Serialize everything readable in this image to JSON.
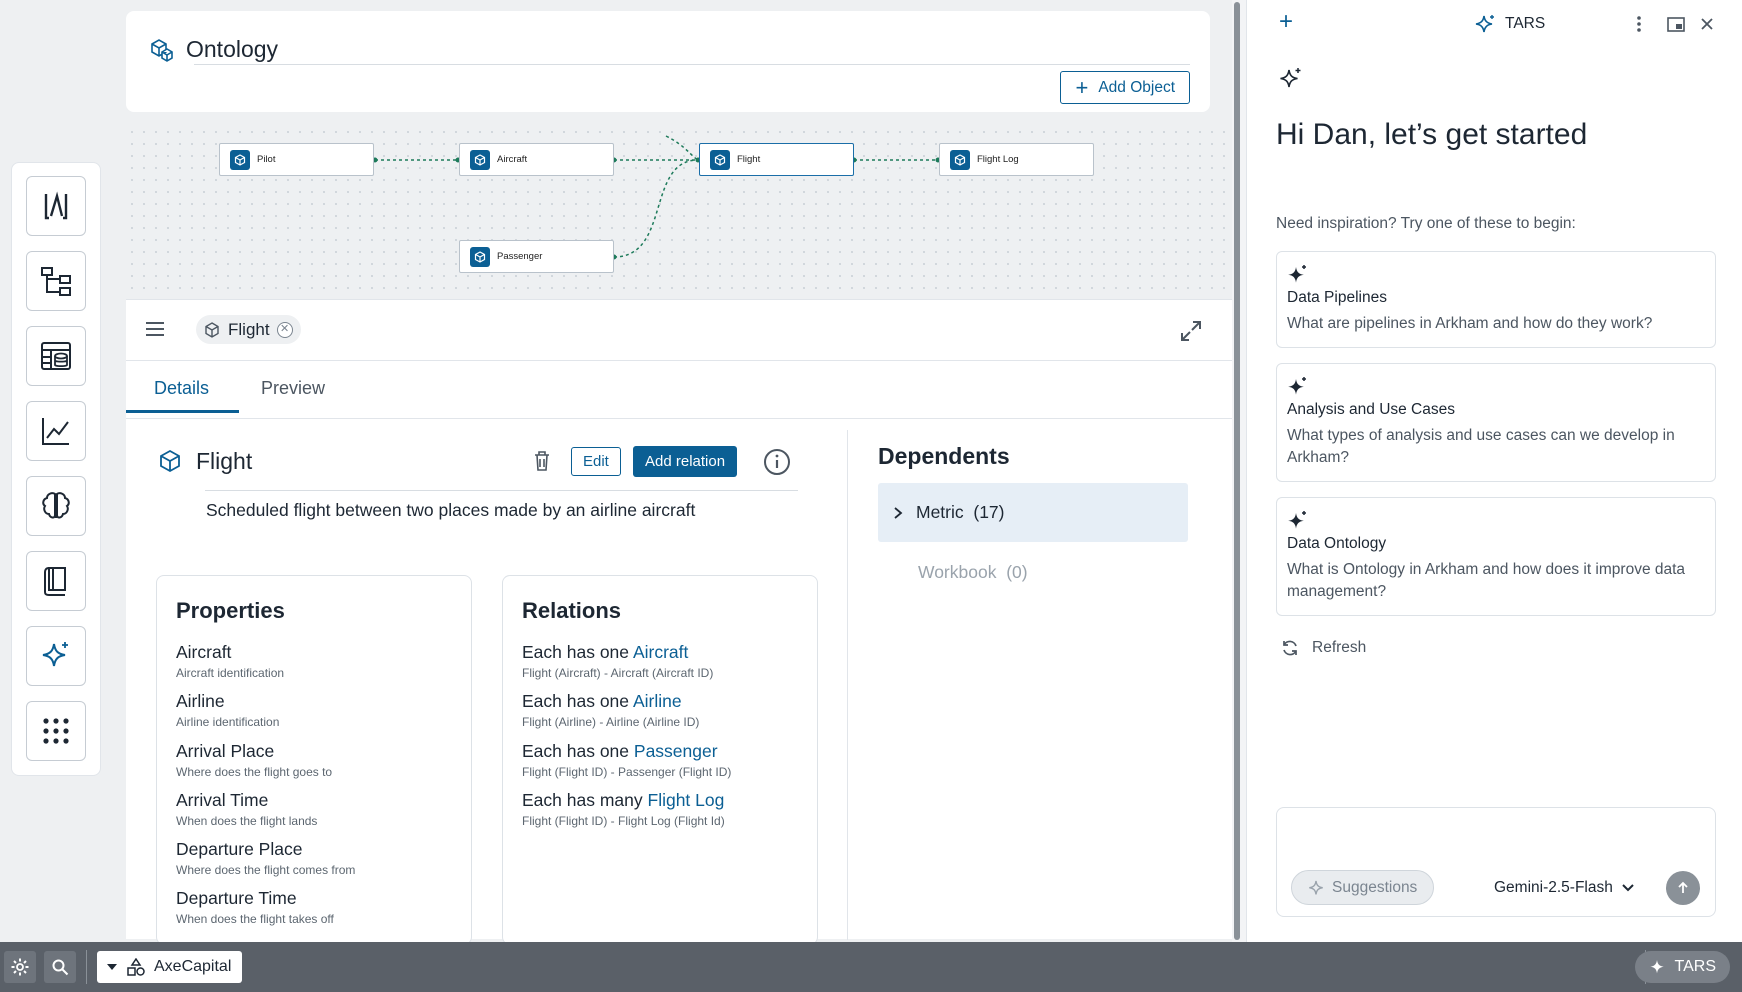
{
  "header": {
    "title": "Ontology",
    "add_object_label": "Add Object"
  },
  "graph": {
    "nodes": [
      "Pilot",
      "Aircraft",
      "Flight",
      "Flight Log",
      "Passenger"
    ]
  },
  "panel": {
    "chip_label": "Flight",
    "tabs": [
      "Details",
      "Preview"
    ],
    "active_tab": "Details",
    "object": {
      "title": "Flight",
      "description": "Scheduled flight between two places made by an airline aircraft",
      "edit_label": "Edit",
      "add_relation_label": "Add relation"
    },
    "properties": {
      "heading": "Properties",
      "items": [
        {
          "name": "Aircraft",
          "desc": "Aircraft identification"
        },
        {
          "name": "Airline",
          "desc": "Airline identification"
        },
        {
          "name": "Arrival Place",
          "desc": "Where does the flight goes to"
        },
        {
          "name": "Arrival Time",
          "desc": "When does the flight lands"
        },
        {
          "name": "Departure Place",
          "desc": "Where does the flight comes from"
        },
        {
          "name": "Departure Time",
          "desc": "When does the flight takes off"
        }
      ]
    },
    "relations": {
      "heading": "Relations",
      "items": [
        {
          "prefix": "Each has one",
          "target": "Aircraft",
          "desc": "Flight (Aircraft) - Aircraft (Aircraft ID)"
        },
        {
          "prefix": "Each has one",
          "target": "Airline",
          "desc": "Flight (Airline) - Airline (Airline ID)"
        },
        {
          "prefix": "Each has one",
          "target": "Passenger",
          "desc": "Flight (Flight ID) - Passenger (Flight ID)"
        },
        {
          "prefix": "Each has many",
          "target": "Flight Log",
          "desc": "Flight (Flight ID) - Flight Log (Flight Id)"
        }
      ]
    },
    "dependents": {
      "heading": "Dependents",
      "rows": [
        {
          "label": "Metric",
          "count": "(17)"
        },
        {
          "label": "Workbook",
          "count": "(0)"
        }
      ]
    }
  },
  "tars": {
    "title": "TARS",
    "greeting": "Hi Dan, let’s get started",
    "inspiration": "Need inspiration? Try one of these to begin:",
    "suggestions": [
      {
        "title": "Data Pipelines",
        "desc": "What are pipelines in Arkham and how do they work?"
      },
      {
        "title": "Analysis and Use Cases",
        "desc": "What types of analysis and use cases can we develop in Arkham?"
      },
      {
        "title": "Data Ontology",
        "desc": "What is Ontology in Arkham and how does it improve data management?"
      }
    ],
    "refresh_label": "Refresh",
    "suggestions_btn": "Suggestions",
    "model": "Gemini-2.5-Flash"
  },
  "bottom": {
    "workspace": "AxeCapital",
    "tars_label": "TARS"
  },
  "colors": {
    "accent": "#0b5f94"
  }
}
